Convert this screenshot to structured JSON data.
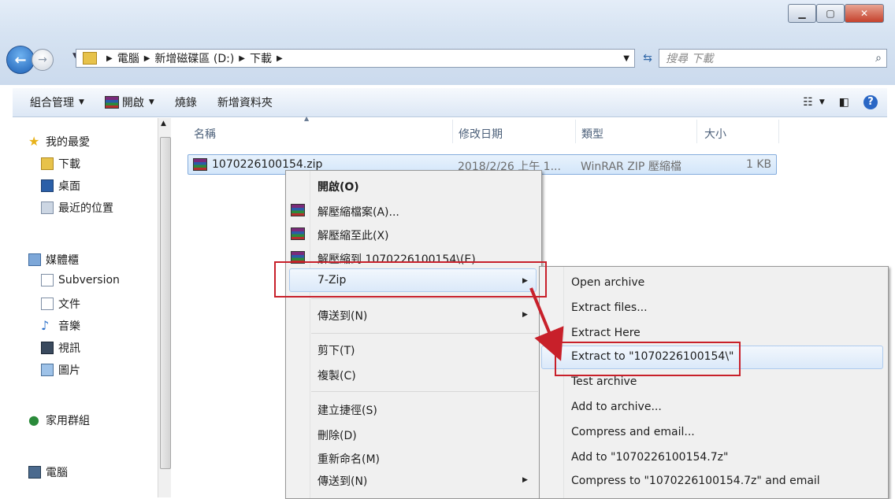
{
  "address": {
    "segments": [
      "電腦",
      "新增磁碟區 (D:)",
      "下載"
    ],
    "search_placeholder": "搜尋 下載"
  },
  "toolbar": {
    "organize": "組合管理",
    "open": "開啟",
    "burn": "燒錄",
    "new_folder": "新增資料夾"
  },
  "nav": {
    "favorites": "我的最愛",
    "downloads": "下載",
    "desktop": "桌面",
    "recent": "最近的位置",
    "libraries": "媒體櫃",
    "subversion": "Subversion",
    "documents": "文件",
    "music": "音樂",
    "videos": "視訊",
    "pictures": "圖片",
    "homegroup": "家用群組",
    "computer": "電腦"
  },
  "columns": {
    "name": "名稱",
    "modified": "修改日期",
    "type": "類型",
    "size": "大小"
  },
  "file": {
    "name": "1070226100154.zip",
    "modified": "2018/2/26 上午 1...",
    "type": "WinRAR ZIP 壓縮檔",
    "size": "1 KB"
  },
  "context_menu": {
    "open": "開啟(O)",
    "extract_files": "解壓縮檔案(A)...",
    "extract_here": "解壓縮至此(X)",
    "extract_to": "解壓縮到 1070226100154\\(E)",
    "seven_zip": "7-Zip",
    "send_to_top": "傳送到(N)",
    "cut": "剪下(T)",
    "copy": "複製(C)",
    "create_shortcut": "建立捷徑(S)",
    "delete": "刪除(D)",
    "rename": "重新命名(M)",
    "send_to_bottom": "傳送到(N)"
  },
  "submenu_7zip": {
    "open_archive": "Open archive",
    "extract_files": "Extract files...",
    "extract_here": "Extract Here",
    "extract_to": "Extract to \"1070226100154\\\"",
    "test_archive": "Test archive",
    "add_to_archive": "Add to archive...",
    "compress_email": "Compress and email...",
    "add_to_7z": "Add to \"1070226100154.7z\"",
    "compress_7z_email": "Compress to \"1070226100154.7z\" and email"
  },
  "colors": {
    "highlight_box": "#c8202a",
    "selection": "#d3e6fa"
  }
}
